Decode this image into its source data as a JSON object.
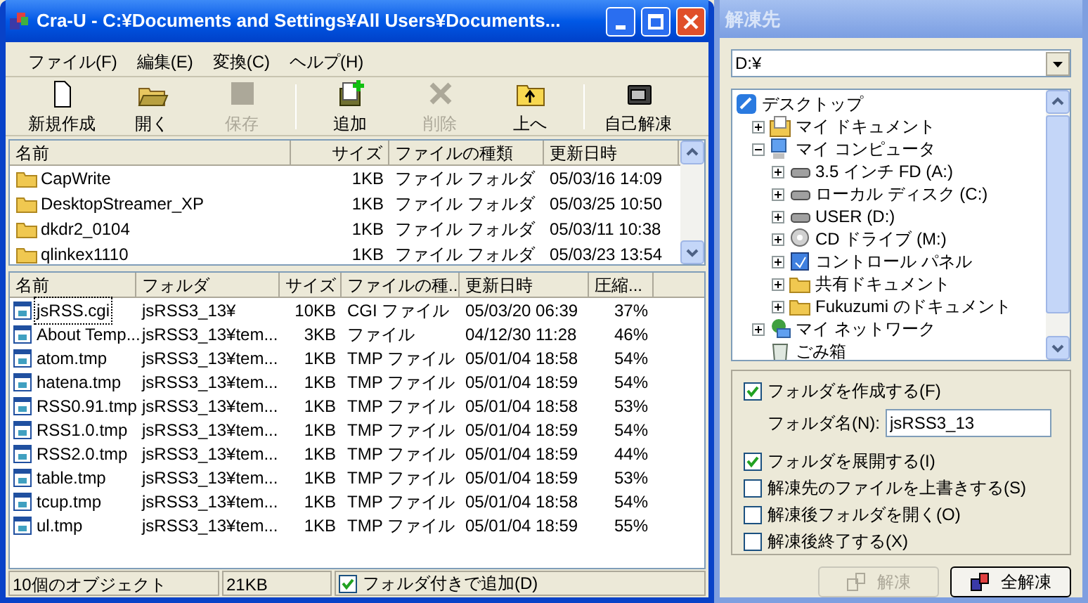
{
  "window": {
    "title": "Cra-U - C:¥Documents and Settings¥All Users¥Documents..."
  },
  "menu": [
    {
      "label": "ファイル(F)"
    },
    {
      "label": "編集(E)"
    },
    {
      "label": "変換(C)"
    },
    {
      "label": "ヘルプ(H)"
    }
  ],
  "toolbar": [
    [
      {
        "label": "新規作成",
        "disabled": false
      },
      {
        "label": "開く",
        "disabled": false
      },
      {
        "label": "保存",
        "disabled": true
      }
    ],
    [
      {
        "label": "追加",
        "disabled": false
      },
      {
        "label": "削除",
        "disabled": true
      },
      {
        "label": "上へ",
        "disabled": false
      }
    ],
    [
      {
        "label": "自己解凍",
        "disabled": false
      }
    ]
  ],
  "folder_list": {
    "columns": [
      "名前",
      "サイズ",
      "ファイルの種類",
      "更新日時"
    ],
    "rows": [
      [
        "CapWrite",
        "1KB",
        "ファイル フォルダ",
        "05/03/16 14:09"
      ],
      [
        "DesktopStreamer_XP",
        "1KB",
        "ファイル フォルダ",
        "05/03/25 10:50"
      ],
      [
        "dkdr2_0104",
        "1KB",
        "ファイル フォルダ",
        "05/03/11 10:38"
      ],
      [
        "qlinkex1110",
        "1KB",
        "ファイル フォルダ",
        "05/03/23 13:54"
      ]
    ]
  },
  "file_list": {
    "columns": [
      "名前",
      "フォルダ",
      "サイズ",
      "ファイルの種...",
      "更新日時",
      "圧縮..."
    ],
    "rows": [
      {
        "selected": true,
        "cells": [
          "jsRSS.cgi",
          "jsRSS3_13¥",
          "10KB",
          "CGI ファイル",
          "05/03/20 06:39",
          "37%"
        ]
      },
      {
        "selected": false,
        "cells": [
          "About Temp...",
          "jsRSS3_13¥tem...",
          "3KB",
          "ファイル",
          "04/12/30 11:28",
          "46%"
        ]
      },
      {
        "selected": false,
        "cells": [
          "atom.tmp",
          "jsRSS3_13¥tem...",
          "1KB",
          "TMP ファイル",
          "05/01/04 18:58",
          "54%"
        ]
      },
      {
        "selected": false,
        "cells": [
          "hatena.tmp",
          "jsRSS3_13¥tem...",
          "1KB",
          "TMP ファイル",
          "05/01/04 18:59",
          "54%"
        ]
      },
      {
        "selected": false,
        "cells": [
          "RSS0.91.tmp",
          "jsRSS3_13¥tem...",
          "1KB",
          "TMP ファイル",
          "05/01/04 18:58",
          "53%"
        ]
      },
      {
        "selected": false,
        "cells": [
          "RSS1.0.tmp",
          "jsRSS3_13¥tem...",
          "1KB",
          "TMP ファイル",
          "05/01/04 18:59",
          "54%"
        ]
      },
      {
        "selected": false,
        "cells": [
          "RSS2.0.tmp",
          "jsRSS3_13¥tem...",
          "1KB",
          "TMP ファイル",
          "05/01/04 18:59",
          "44%"
        ]
      },
      {
        "selected": false,
        "cells": [
          "table.tmp",
          "jsRSS3_13¥tem...",
          "1KB",
          "TMP ファイル",
          "05/01/04 18:59",
          "53%"
        ]
      },
      {
        "selected": false,
        "cells": [
          "tcup.tmp",
          "jsRSS3_13¥tem...",
          "1KB",
          "TMP ファイル",
          "05/01/04 18:58",
          "54%"
        ]
      },
      {
        "selected": false,
        "cells": [
          "ul.tmp",
          "jsRSS3_13¥tem...",
          "1KB",
          "TMP ファイル",
          "05/01/04 18:59",
          "55%"
        ]
      }
    ]
  },
  "status_bar": {
    "count": "10個のオブジェクト",
    "size": "21KB",
    "option": {
      "label": "フォルダ付きで追加(D)",
      "checked": true
    }
  },
  "dialog": {
    "title": "解凍先",
    "path": "D:¥",
    "tree": [
      {
        "label": "デスクトップ",
        "children": [
          {
            "label": "マイ ドキュメント",
            "expanded": false
          },
          {
            "label": "マイ コンピュータ",
            "expanded": true,
            "children": [
              {
                "label": "3.5 インチ FD (A:)",
                "expanded": false
              },
              {
                "label": "ローカル ディスク (C:)",
                "expanded": false
              },
              {
                "label": "USER (D:)",
                "expanded": false
              },
              {
                "label": "CD ドライブ (M:)",
                "expanded": false
              },
              {
                "label": "コントロール パネル",
                "expanded": false
              },
              {
                "label": "共有ドキュメント",
                "expanded": false
              },
              {
                "label": "Fukuzumi のドキュメント",
                "expanded": false
              }
            ]
          },
          {
            "label": "マイ ネットワーク",
            "expanded": false
          },
          {
            "label": "ごみ箱"
          }
        ]
      }
    ],
    "options": [
      {
        "kind": "checkbox",
        "label": "フォルダを作成する(F)",
        "checked": true
      },
      {
        "kind": "field",
        "label": "フォルダ名(N):",
        "value": "jsRSS3_13"
      },
      {
        "kind": "checkbox",
        "label": "フォルダを展開する(I)",
        "checked": true
      },
      {
        "kind": "checkbox",
        "label": "解凍先のファイルを上書きする(S)",
        "checked": false
      },
      {
        "kind": "checkbox",
        "label": "解凍後フォルダを開く(O)",
        "checked": false
      },
      {
        "kind": "checkbox",
        "label": "解凍後終了する(X)",
        "checked": false
      }
    ],
    "buttons": [
      {
        "label": "解凍",
        "disabled": true
      },
      {
        "label": "全解凍",
        "disabled": false
      }
    ]
  }
}
